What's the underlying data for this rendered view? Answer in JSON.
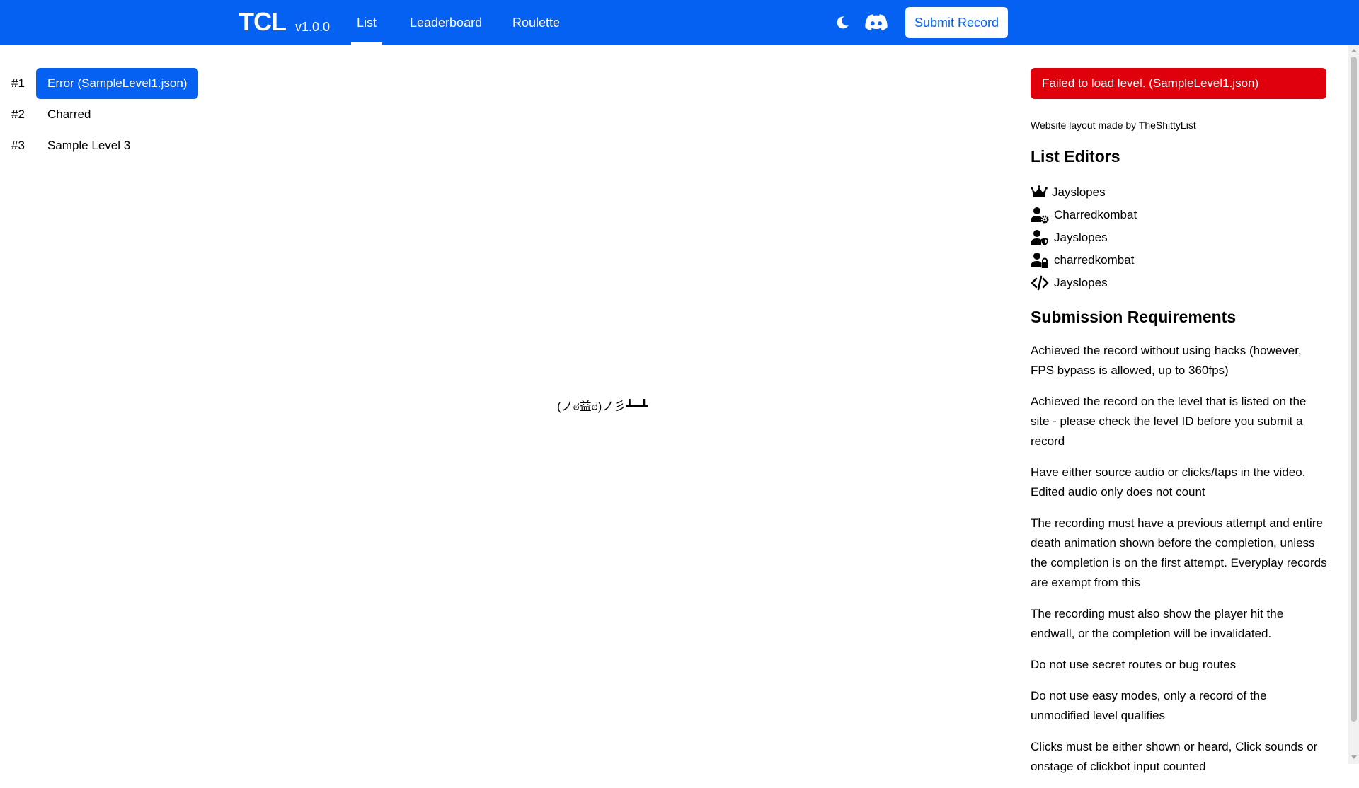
{
  "header": {
    "logo": "TCL",
    "version": "v1.0.0",
    "tabs": [
      {
        "label": "List",
        "active": true
      },
      {
        "label": "Leaderboard",
        "active": false
      },
      {
        "label": "Roulette",
        "active": false
      }
    ],
    "theme_icon": "moon-icon",
    "discord_icon": "discord-icon",
    "submit_label": "Submit Record",
    "color": "#0461f2"
  },
  "levels": [
    {
      "rank": "#1",
      "name": "Error (SampleLevel1.json)",
      "selected": true
    },
    {
      "rank": "#2",
      "name": "Charred",
      "selected": false
    },
    {
      "rank": "#3",
      "name": "Sample Level 3",
      "selected": false
    }
  ],
  "center": {
    "message": "(ノಠ益ಠ)ノ彡┻━┻"
  },
  "sidebar": {
    "error": "Failed to load level. (SampleLevel1.json)",
    "error_color": "#e0000b",
    "credit": "Website layout made by TheShittyList",
    "editors_title": "List Editors",
    "editors": [
      {
        "icon": "crown-icon",
        "name": "Jayslopes"
      },
      {
        "icon": "user-gear-icon",
        "name": "Charredkombat"
      },
      {
        "icon": "user-shield-icon",
        "name": "Jayslopes"
      },
      {
        "icon": "user-lock-icon",
        "name": "charredkombat"
      },
      {
        "icon": "code-icon",
        "name": "Jayslopes"
      }
    ],
    "requirements_title": "Submission Requirements",
    "requirements": [
      "Achieved the record without using hacks (however, FPS bypass is allowed, up to 360fps)",
      "Achieved the record on the level that is listed on the site - please check the level ID before you submit a record",
      "Have either source audio or clicks/taps in the video. Edited audio only does not count",
      "The recording must have a previous attempt and entire death animation shown before the completion, unless the completion is on the first attempt. Everyplay records are exempt from this",
      "The recording must also show the player hit the endwall, or the completion will be invalidated.",
      "Do not use secret routes or bug routes",
      "Do not use easy modes, only a record of the unmodified level qualifies",
      "Clicks must be either shown or heard, Click sounds or onstage of clickbot input counted"
    ]
  }
}
